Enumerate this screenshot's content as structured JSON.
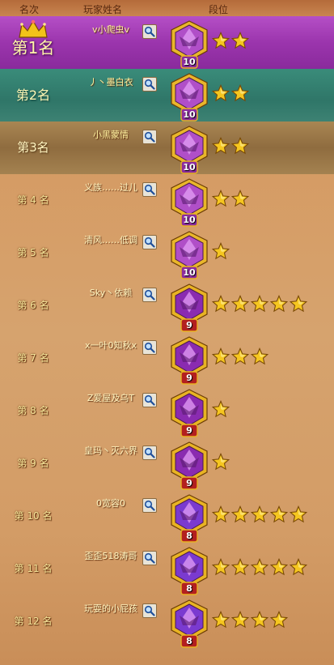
{
  "header": {
    "rank_col": "名次",
    "name_col": "玩家姓名",
    "tier_col": "段位"
  },
  "colors": {
    "gold": "#f2c21a",
    "purple_badge": "#a23ec0",
    "red_badge": "#b51f1f"
  },
  "rows": [
    {
      "rank": "第1名",
      "name": "v小爬虫v",
      "tier_level": "10",
      "stars": 2,
      "badge_style": "purple-gold"
    },
    {
      "rank": "第2名",
      "name": "丿丶墨白衣",
      "tier_level": "10",
      "stars": 2,
      "badge_style": "purple-gold"
    },
    {
      "rank": "第3名",
      "name": "小黑蒙情",
      "tier_level": "10",
      "stars": 2,
      "badge_style": "purple-gold"
    },
    {
      "rank": "第 4 名",
      "name": "义族……过儿",
      "tier_level": "10",
      "stars": 2,
      "badge_style": "purple-gold"
    },
    {
      "rank": "第 5 名",
      "name": "清风……低调",
      "tier_level": "10",
      "stars": 1,
      "badge_style": "purple-gold"
    },
    {
      "rank": "第 6 名",
      "name": "Sky丶依赖",
      "tier_level": "9",
      "stars": 5,
      "badge_style": "red-gold"
    },
    {
      "rank": "第 7 名",
      "name": "x一叶0知秋x",
      "tier_level": "9",
      "stars": 3,
      "badge_style": "red-gold"
    },
    {
      "rank": "第 8 名",
      "name": "Z爱屋及乌T",
      "tier_level": "9",
      "stars": 1,
      "badge_style": "red-gold"
    },
    {
      "rank": "第 9 名",
      "name": "皇玛丶灭六界",
      "tier_level": "9",
      "stars": 1,
      "badge_style": "red-gold"
    },
    {
      "rank": "第 10 名",
      "name": "0宽容0",
      "tier_level": "8",
      "stars": 5,
      "badge_style": "red-violet"
    },
    {
      "rank": "第 11 名",
      "name": "歪歪518涛哥",
      "tier_level": "8",
      "stars": 5,
      "badge_style": "red-violet"
    },
    {
      "rank": "第 12 名",
      "name": "玩耍的小屁孩",
      "tier_level": "8",
      "stars": 4,
      "badge_style": "red-violet"
    }
  ]
}
